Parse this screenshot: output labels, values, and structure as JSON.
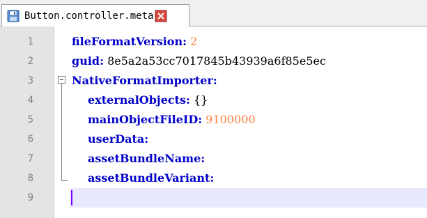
{
  "tab": {
    "title": "Button.controller.meta",
    "icon": "save-icon",
    "close_icon": "close-icon"
  },
  "colors": {
    "key": "#0000c8",
    "number": "#ff8040",
    "line_number": "#808080",
    "current_line": "#e8e8ff",
    "caret": "#8000ff"
  },
  "lines": [
    {
      "n": "1",
      "key": "fileFormatVersion:",
      "val": "2",
      "val_type": "num"
    },
    {
      "n": "2",
      "key": "guid:",
      "val": "8e5a2a53cc7017845b43939a6f85e5ec",
      "val_type": "plain"
    },
    {
      "n": "3",
      "key": "NativeFormatImporter:",
      "val": "",
      "val_type": "plain"
    },
    {
      "n": "4",
      "key": "externalObjects:",
      "val": "{}",
      "val_type": "plain"
    },
    {
      "n": "5",
      "key": "mainObjectFileID:",
      "val": "9100000",
      "val_type": "num"
    },
    {
      "n": "6",
      "key": "userData:",
      "val": "",
      "val_type": "plain"
    },
    {
      "n": "7",
      "key": "assetBundleName:",
      "val": "",
      "val_type": "plain"
    },
    {
      "n": "8",
      "key": "assetBundleVariant:",
      "val": "",
      "val_type": "plain"
    },
    {
      "n": "9",
      "key": "",
      "val": "",
      "val_type": "plain"
    }
  ],
  "current_line": "9"
}
